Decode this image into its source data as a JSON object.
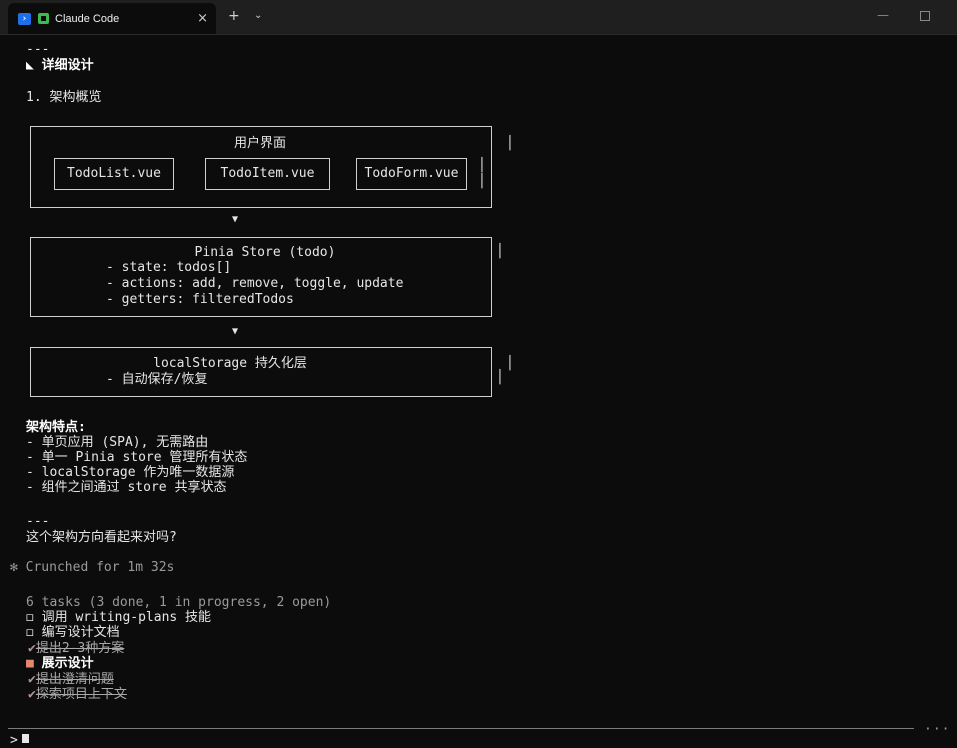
{
  "window": {
    "tab_title": "Claude Code",
    "close_glyph": "×",
    "new_tab_glyph": "+",
    "tab_menu_glyph": "⌄",
    "minimize_glyph": "—",
    "icons": [
      "powershell-icon",
      "claude-code-icon"
    ]
  },
  "terminal": {
    "sep_top": "---",
    "heading": "◣ 详细设计",
    "section_1": "1. 架构概览",
    "ui_box": {
      "title": "用户界面",
      "components": [
        "TodoList.vue",
        "TodoItem.vue",
        "TodoForm.vue"
      ]
    },
    "arrow": "▼",
    "store_box": {
      "title": "Pinia Store (todo)",
      "state": "- state: todos[]",
      "actions": "- actions: add, remove, toggle, update",
      "getters": "- getters: filteredTodos"
    },
    "storage_box": {
      "title": "localStorage 持久化层",
      "desc": "- 自动保存/恢复"
    },
    "features": {
      "title": "架构特点:",
      "items": [
        "- 单页应用 (SPA), 无需路由",
        "- 单一 Pinia store 管理所有状态",
        "- localStorage 作为唯一数据源",
        "- 组件之间通过 store 共享状态"
      ]
    },
    "sep_bottom": "---",
    "question": "这个架构方向看起来对吗?",
    "crunched": "✻ Crunched for 1m 32s",
    "tasks": {
      "summary": "6 tasks (3 done, 1 in progress, 2 open)",
      "open_marker": "◻",
      "done_marker": "✔",
      "progress_marker": "■",
      "items": [
        {
          "label": "调用 writing-plans 技能",
          "status": "open"
        },
        {
          "label": "编写设计文档",
          "status": "open"
        },
        {
          "label": "提出2-3种方案",
          "status": "done"
        },
        {
          "label": "展示设计",
          "status": "in_progress"
        },
        {
          "label": "提出澄清问题",
          "status": "done"
        },
        {
          "label": "探索项目上下文",
          "status": "done"
        }
      ]
    },
    "prompt": ">",
    "overflow_dots": "···"
  }
}
